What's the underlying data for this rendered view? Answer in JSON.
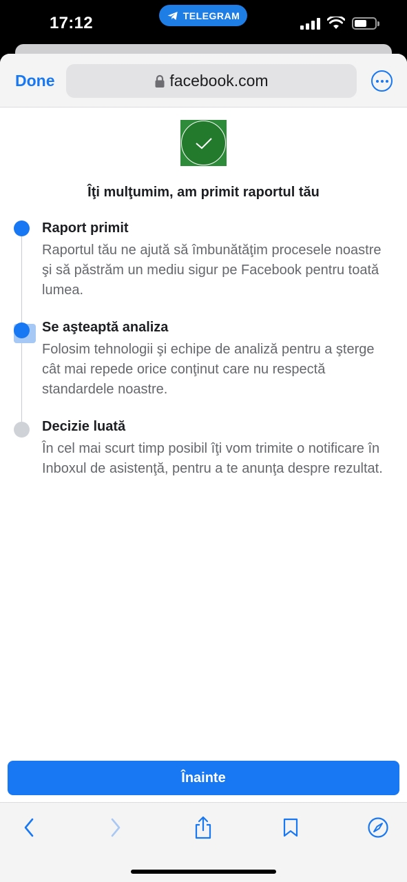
{
  "status_bar": {
    "time": "17:12",
    "return_app": "TELEGRAM",
    "battery_level": 0.6
  },
  "browser": {
    "done_label": "Done",
    "url": "facebook.com",
    "accent_color": "#1877f2"
  },
  "page": {
    "headline": "Îţi mulţumim, am primit raportul tău",
    "steps": [
      {
        "title": "Raport primit",
        "description": "Raportul tău ne ajută să îmbunătăţim procesele noastre şi să păstrăm un mediu sigur pe Facebook pentru toată lumea.",
        "status": "completed"
      },
      {
        "title": "Se aşteaptă analiza",
        "description": "Folosim tehnologii şi echipe de analiză pentru a şterge cât mai repede orice conţinut care nu respectă standardele noastre.",
        "status": "current"
      },
      {
        "title": "Decizie luată",
        "description": "În cel mai scurt timp posibil îţi vom trimite o notificare în Inboxul de asistenţă, pentru a te anunţa despre rezultat.",
        "status": "pending"
      }
    ],
    "next_button": "Înainte"
  },
  "toolbar": {
    "icons": [
      "back-icon",
      "forward-icon",
      "share-icon",
      "bookmarks-icon",
      "compass-icon"
    ]
  }
}
